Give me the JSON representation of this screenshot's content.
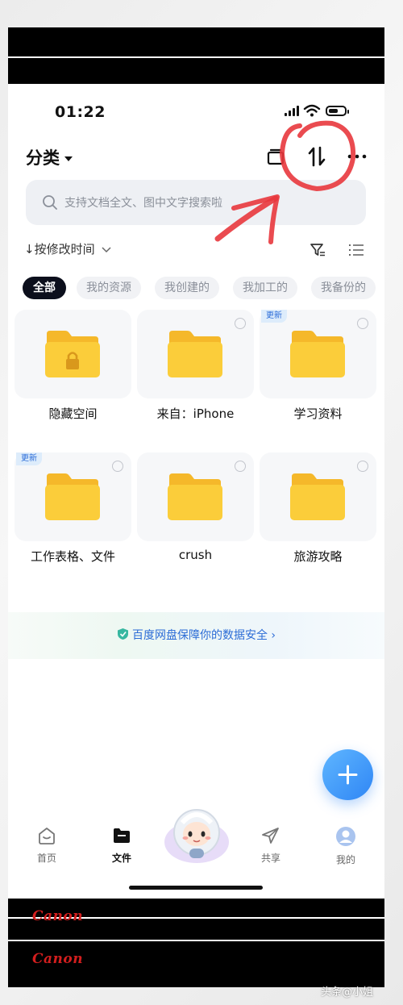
{
  "status_bar": {
    "time": "01:22"
  },
  "header": {
    "title": "分类"
  },
  "search": {
    "placeholder": "支持文档全文、图中文字搜索啦"
  },
  "sort": {
    "label": "↓按修改时间"
  },
  "filters": [
    {
      "label": "全部",
      "active": true
    },
    {
      "label": "我的资源",
      "active": false
    },
    {
      "label": "我创建的",
      "active": false
    },
    {
      "label": "我加工的",
      "active": false
    },
    {
      "label": "我备份的",
      "active": false
    }
  ],
  "folders": [
    {
      "name": "隐藏空间",
      "badge": "",
      "locked": true
    },
    {
      "name": "来自：iPhone",
      "badge": ""
    },
    {
      "name": "学习资料",
      "badge": "更新"
    },
    {
      "name": "工作表格、文件",
      "badge": "更新"
    },
    {
      "name": "crush",
      "badge": ""
    },
    {
      "name": "旅游攻略",
      "badge": ""
    }
  ],
  "banner": {
    "text": "百度网盘保障你的数据安全 ›"
  },
  "tabbar": [
    {
      "label": "首页",
      "icon": "home-icon"
    },
    {
      "label": "文件",
      "icon": "folder-icon",
      "active": true
    },
    {
      "label": "",
      "icon": "mascot-icon"
    },
    {
      "label": "共享",
      "icon": "share-icon"
    },
    {
      "label": "我的",
      "icon": "profile-icon"
    }
  ],
  "photo": {
    "brand_top": "Canon",
    "brand_bottom": "Canon",
    "watermark": "头条@小姐"
  },
  "colors": {
    "accent": "#2f86f5",
    "folder": "#f9c933",
    "annotation": "#e8373d"
  }
}
